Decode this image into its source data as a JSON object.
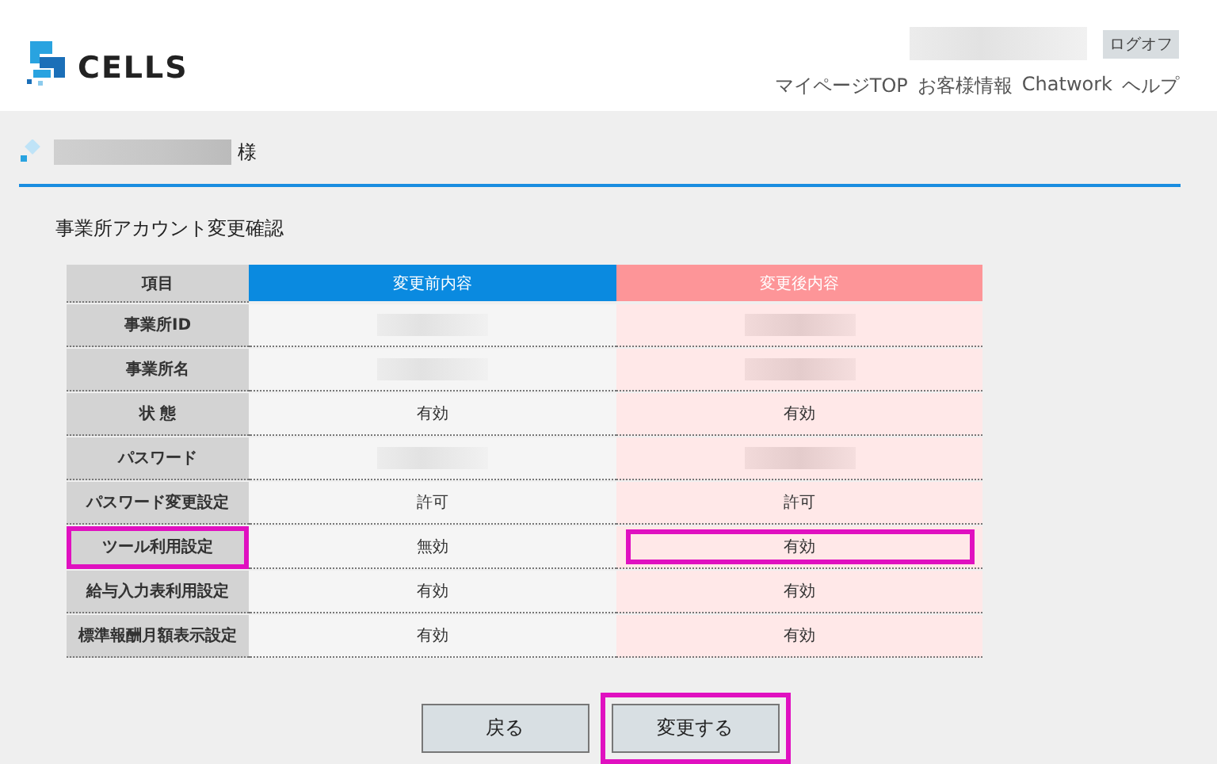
{
  "header": {
    "logo_text": "CELLS",
    "logoff": "ログオフ",
    "nav": [
      "マイページTOP",
      "お客様情報",
      "Chatwork",
      "ヘルプ"
    ]
  },
  "customer": {
    "suffix": "様"
  },
  "title": "事業所アカウント変更確認",
  "table": {
    "columns": [
      "項目",
      "変更前内容",
      "変更後内容"
    ],
    "rows": [
      {
        "label": "事業所ID",
        "label_highlighted": false,
        "before": {
          "kind": "redacted"
        },
        "after": {
          "kind": "redacted"
        },
        "after_highlighted": false
      },
      {
        "label": "事業所名",
        "label_highlighted": false,
        "before": {
          "kind": "redacted"
        },
        "after": {
          "kind": "redacted"
        },
        "after_highlighted": false
      },
      {
        "label": "状 態",
        "label_highlighted": false,
        "before": {
          "kind": "text",
          "text": "有効"
        },
        "after": {
          "kind": "text",
          "text": "有効"
        },
        "after_highlighted": false
      },
      {
        "label": "パスワード",
        "label_highlighted": false,
        "before": {
          "kind": "redacted"
        },
        "after": {
          "kind": "redacted"
        },
        "after_highlighted": false
      },
      {
        "label": "パスワード変更設定",
        "label_highlighted": false,
        "before": {
          "kind": "text",
          "text": "許可"
        },
        "after": {
          "kind": "text",
          "text": "許可"
        },
        "after_highlighted": false
      },
      {
        "label": "ツール利用設定",
        "label_highlighted": true,
        "before": {
          "kind": "text",
          "text": "無効"
        },
        "after": {
          "kind": "text",
          "text": "有効"
        },
        "after_highlighted": true
      },
      {
        "label": "給与入力表利用設定",
        "label_highlighted": false,
        "before": {
          "kind": "text",
          "text": "有効"
        },
        "after": {
          "kind": "text",
          "text": "有効"
        },
        "after_highlighted": false
      },
      {
        "label": "標準報酬月額表示設定",
        "label_highlighted": false,
        "before": {
          "kind": "text",
          "text": "有効"
        },
        "after": {
          "kind": "text",
          "text": "有効"
        },
        "after_highlighted": false
      }
    ]
  },
  "buttons": [
    {
      "label": "戻る",
      "highlighted": false
    },
    {
      "label": "変更する",
      "highlighted": true
    }
  ]
}
